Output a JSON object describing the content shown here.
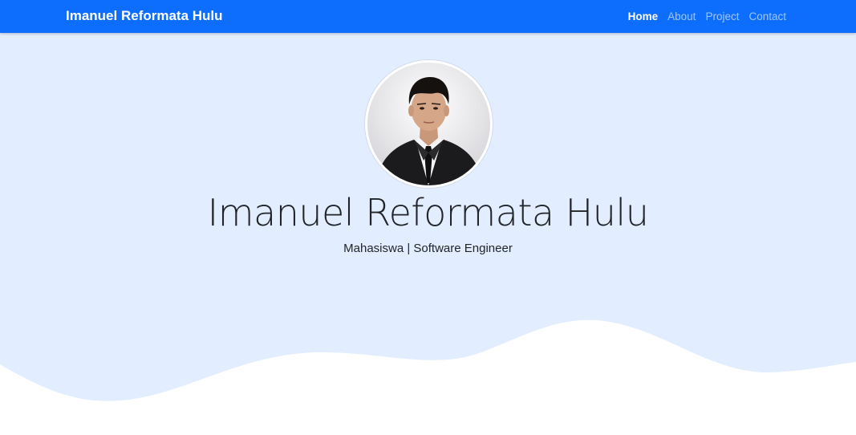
{
  "navbar": {
    "brand": "Imanuel Reformata Hulu",
    "links": [
      {
        "label": "Home",
        "active": true
      },
      {
        "label": "About",
        "active": false
      },
      {
        "label": "Project",
        "active": false
      },
      {
        "label": "Contact",
        "active": false
      }
    ]
  },
  "hero": {
    "title": "Imanuel Reformata Hulu",
    "subtitle": "Mahasiswa | Software Engineer",
    "avatar_alt": "profile photo"
  },
  "colors": {
    "navbar": "#0d6efd",
    "hero_background": "#e2edff",
    "wave": "#ffffff"
  }
}
